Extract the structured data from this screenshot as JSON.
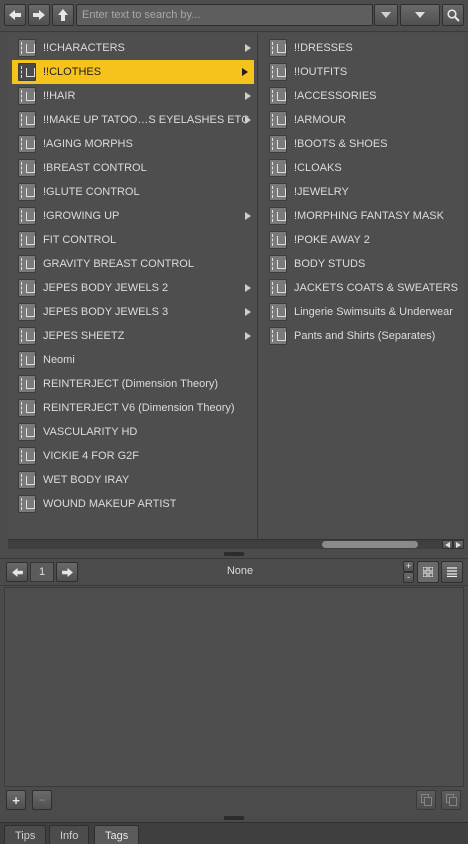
{
  "toolbar": {
    "back_icon": "arrow-left-icon",
    "forward_icon": "arrow-right-icon",
    "up_icon": "arrow-up-icon",
    "search_placeholder": "Enter text to search by...",
    "search_value": ""
  },
  "left_list": [
    {
      "label": "!!CHARACTERS",
      "has_children": true,
      "selected": false
    },
    {
      "label": "!!CLOTHES",
      "has_children": true,
      "selected": true
    },
    {
      "label": "!!HAIR",
      "has_children": true,
      "selected": false
    },
    {
      "label": "!!MAKE UP TATOO…S EYELASHES ETC",
      "has_children": true,
      "selected": false
    },
    {
      "label": "!AGING MORPHS",
      "has_children": false,
      "selected": false
    },
    {
      "label": "!BREAST CONTROL",
      "has_children": false,
      "selected": false
    },
    {
      "label": "!GLUTE CONTROL",
      "has_children": false,
      "selected": false
    },
    {
      "label": "!GROWING UP",
      "has_children": true,
      "selected": false
    },
    {
      "label": "FIT CONTROL",
      "has_children": false,
      "selected": false
    },
    {
      "label": "GRAVITY BREAST CONTROL",
      "has_children": false,
      "selected": false
    },
    {
      "label": "JEPES BODY JEWELS 2",
      "has_children": true,
      "selected": false
    },
    {
      "label": "JEPES BODY JEWELS 3",
      "has_children": true,
      "selected": false
    },
    {
      "label": "JEPES SHEETZ",
      "has_children": true,
      "selected": false
    },
    {
      "label": "Neomi",
      "has_children": false,
      "selected": false
    },
    {
      "label": "REINTERJECT (Dimension Theory)",
      "has_children": false,
      "selected": false
    },
    {
      "label": "REINTERJECT V6 (Dimension Theory)",
      "has_children": false,
      "selected": false
    },
    {
      "label": "VASCULARITY HD",
      "has_children": false,
      "selected": false
    },
    {
      "label": "VICKIE 4 FOR G2F",
      "has_children": false,
      "selected": false
    },
    {
      "label": "WET BODY IRAY",
      "has_children": false,
      "selected": false
    },
    {
      "label": "WOUND MAKEUP ARTIST",
      "has_children": false,
      "selected": false
    }
  ],
  "right_list": [
    {
      "label": "!!DRESSES"
    },
    {
      "label": "!!OUTFITS"
    },
    {
      "label": "!ACCESSORIES"
    },
    {
      "label": "!ARMOUR"
    },
    {
      "label": "!BOOTS & SHOES"
    },
    {
      "label": "!CLOAKS"
    },
    {
      "label": "!JEWELRY"
    },
    {
      "label": "!MORPHING FANTASY MASK"
    },
    {
      "label": "!POKE AWAY 2"
    },
    {
      "label": "BODY STUDS"
    },
    {
      "label": "JACKETS COATS & SWEATERS"
    },
    {
      "label": "Lingerie Swimsuits & Underwear"
    },
    {
      "label": "Pants and Shirts (Separates)"
    }
  ],
  "pager": {
    "page": "1",
    "sort_label": "None"
  },
  "bottom_buttons": {
    "add": "+",
    "remove": "−"
  },
  "tabs": [
    {
      "label": "Tips",
      "active": false
    },
    {
      "label": "Info",
      "active": false
    },
    {
      "label": "Tags",
      "active": true
    }
  ],
  "colors": {
    "selection": "#f6c21c",
    "panel_bg": "#4e4e4e"
  }
}
